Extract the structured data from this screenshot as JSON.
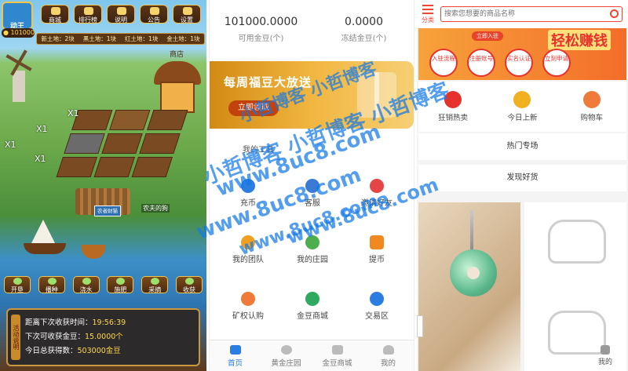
{
  "game": {
    "top_buttons": [
      "商城",
      "排行榜",
      "说明",
      "公告",
      "设置"
    ],
    "avatar_label": "动王",
    "coins": "101000",
    "land_bar": [
      "新土地：2块",
      "黑土地：1块",
      "红土地：1块",
      "金土地：1块"
    ],
    "shop_label": "商店",
    "multipliers": [
      "X1",
      "X1",
      "X1",
      "X1"
    ],
    "sign_text": "农者财猫",
    "dog_label": "农夫的狗",
    "actions": [
      "开垦",
      "播种",
      "浇水",
      "施肥",
      "采摘",
      "收获"
    ],
    "info_side": "活动说明",
    "info": {
      "next_harvest_label": "距离下次收获时间：",
      "next_harvest_value": "19:56:39",
      "next_coins_label": "下次可收获金豆：",
      "next_coins_value": "15.0000个",
      "today_label": "今日总获得数：",
      "today_value": "503000金豆"
    }
  },
  "wallet": {
    "available_value": "101000.0000",
    "available_label": "可用金豆(个)",
    "frozen_value": "0.0000",
    "frozen_label": "冻结金豆(个)",
    "promo_title": "每周福豆大放送",
    "promo_button": "立即领取",
    "tools_title": "我的工具",
    "tools": [
      "充币",
      "客服",
      "邀请好友",
      "我的团队",
      "我的庄园",
      "提币",
      "矿权认购",
      "金豆商城",
      "交易区"
    ],
    "tabs": [
      "首页",
      "黄金庄园",
      "金豆商城",
      "我的"
    ],
    "active_tab": 0
  },
  "shop": {
    "category_label": "分类",
    "search_placeholder": "搜索您想要的商品名称",
    "banner_pill": "立即入驻",
    "banner_title": "轻松赚钱",
    "banner_steps": [
      "入驻流程",
      "注册账号",
      "实名认证",
      "立刻申请"
    ],
    "icons": [
      "狂销热卖",
      "今日上新",
      "购物车"
    ],
    "sections": [
      "热门专场",
      "发现好货"
    ],
    "me_tab": "我的"
  },
  "watermarks": [
    "小哲博客 小哲博客",
    "小哲博客 小哲博客 小哲博客",
    "www.8uc8.com",
    "www.8uc8.com",
    "www.8uc8.com",
    "www.8uc8.com"
  ],
  "colors": {
    "accent_blue": "#2b7de1",
    "shop_red": "#e43",
    "promo_orange": "#f1b640",
    "coin_yellow": "#ffd94a"
  }
}
